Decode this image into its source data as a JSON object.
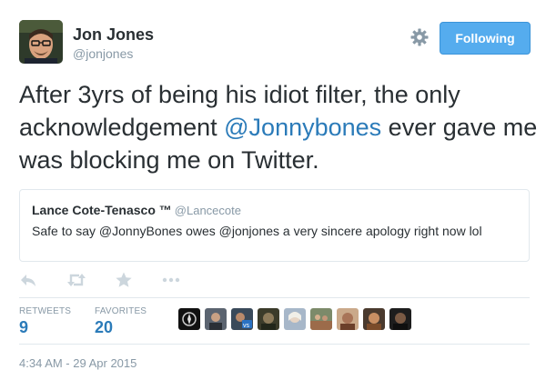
{
  "author": {
    "name": "Jon Jones",
    "handle": "@jonjones"
  },
  "follow_button": {
    "label": "Following"
  },
  "tweet": {
    "text_before": "After 3yrs of being his idiot filter, the only acknowledgement ",
    "mention": "@Jonnybones",
    "text_after": " ever gave me was blocking me on Twitter."
  },
  "quoted_tweet": {
    "name": "Lance Cote-Tenasco ™",
    "handle": "@Lancecote",
    "text": "Safe to say @JonnyBones owes @jonjones a very sincere apology right now lol"
  },
  "actions": [
    {
      "icon": "reply-icon"
    },
    {
      "icon": "retweet-icon"
    },
    {
      "icon": "favorite-star-icon"
    },
    {
      "icon": "more-icon"
    }
  ],
  "stats": {
    "retweets_label": "RETWEETS",
    "retweets_count": "9",
    "favorites_label": "FAVORITES",
    "favorites_count": "20"
  },
  "favoriters": [
    "favoriter-avatar-1",
    "favoriter-avatar-2",
    "favoriter-avatar-3",
    "favoriter-avatar-4",
    "favoriter-avatar-5",
    "favoriter-avatar-6",
    "favoriter-avatar-7",
    "favoriter-avatar-8",
    "favoriter-avatar-9"
  ],
  "timestamp": "4:34 AM - 29 Apr 2015",
  "colors": {
    "accent": "#55acee",
    "link": "#2b7bb9",
    "muted": "#8899a6",
    "text": "#292f33",
    "border": "#e1e8ed"
  }
}
